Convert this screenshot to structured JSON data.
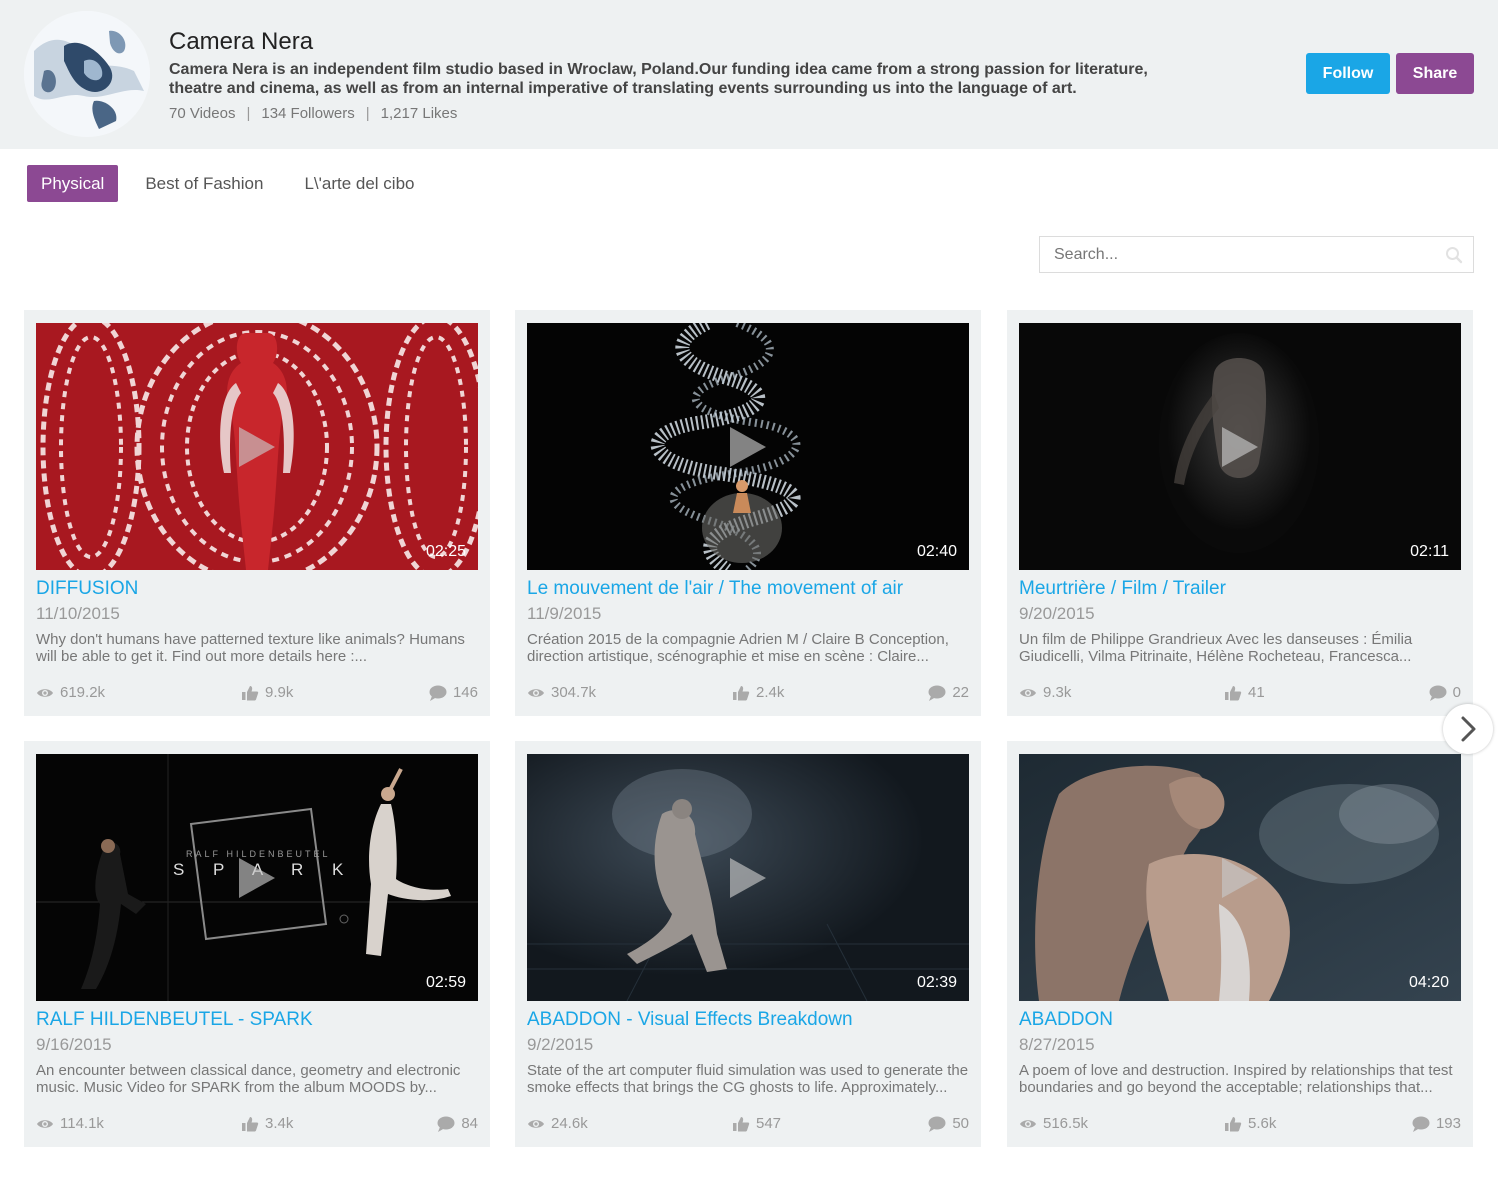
{
  "channel": {
    "name": "Camera Nera",
    "description": "Camera Nera is an independent film studio based in Wroclaw, Poland.Our funding idea came from a strong passion for literature, theatre and cinema, as well as from an internal imperative of translating events surrounding us into the language of art.",
    "videos": "70 Videos",
    "followers": "134 Followers",
    "likes": "1,217 Likes",
    "separator": "|"
  },
  "actions": {
    "follow_label": "Follow",
    "share_label": "Share"
  },
  "colors": {
    "accent_blue": "#1aa6e6",
    "accent_purple": "#8c4993",
    "header_bg": "#eef1f2"
  },
  "tabs": [
    {
      "label": "Physical",
      "active": true
    },
    {
      "label": "Best of Fashion",
      "active": false
    },
    {
      "label": "L\\'arte del cibo",
      "active": false
    }
  ],
  "search": {
    "placeholder": "Search..."
  },
  "icons": {
    "view": "eye-icon",
    "like": "thumbs-up-icon",
    "comment": "comment-bubble-icon",
    "play": "play-icon",
    "search": "search-icon",
    "next": "chevron-right-icon"
  },
  "videos": [
    {
      "title": "DIFFUSION",
      "date": "11/10/2015",
      "duration": "02:25",
      "description": "Why don't humans have patterned texture like animals? Humans will be able to get it. Find out more details here :...",
      "views": "619.2k",
      "likes": "9.9k",
      "comments": "146"
    },
    {
      "title": "Le mouvement de l'air / The movement of air",
      "date": "11/9/2015",
      "duration": "02:40",
      "description": "Création 2015 de la compagnie Adrien M / Claire B Conception, direction artistique, scénographie et mise en scène : Claire...",
      "views": "304.7k",
      "likes": "2.4k",
      "comments": "22"
    },
    {
      "title": "Meurtrière / Film / Trailer",
      "date": "9/20/2015",
      "duration": "02:11",
      "description": "Un film de Philippe Grandrieux Avec les danseuses : Émilia Giudicelli, Vilma Pitrinaite, Hélène Rocheteau, Francesca...",
      "views": "9.3k",
      "likes": "41",
      "comments": "0"
    },
    {
      "title": "RALF HILDENBEUTEL - SPARK",
      "date": "9/16/2015",
      "duration": "02:59",
      "description": "An encounter between classical dance, geometry and electronic music. Music Video for SPARK from the album MOODS by...",
      "views": "114.1k",
      "likes": "3.4k",
      "comments": "84",
      "thumb_text_top": "RALF HILDENBEUTEL",
      "thumb_text_main": "S P A R K"
    },
    {
      "title": "ABADDON - Visual Effects Breakdown",
      "date": "9/2/2015",
      "duration": "02:39",
      "description": "State of the art computer fluid simulation was used to generate the smoke effects that brings the CG ghosts to life. Approximately...",
      "views": "24.6k",
      "likes": "547",
      "comments": "50"
    },
    {
      "title": "ABADDON",
      "date": "8/27/2015",
      "duration": "04:20",
      "description": "A poem of love and destruction. Inspired by relationships that test boundaries and go beyond the acceptable; relationships that...",
      "views": "516.5k",
      "likes": "5.6k",
      "comments": "193"
    }
  ]
}
